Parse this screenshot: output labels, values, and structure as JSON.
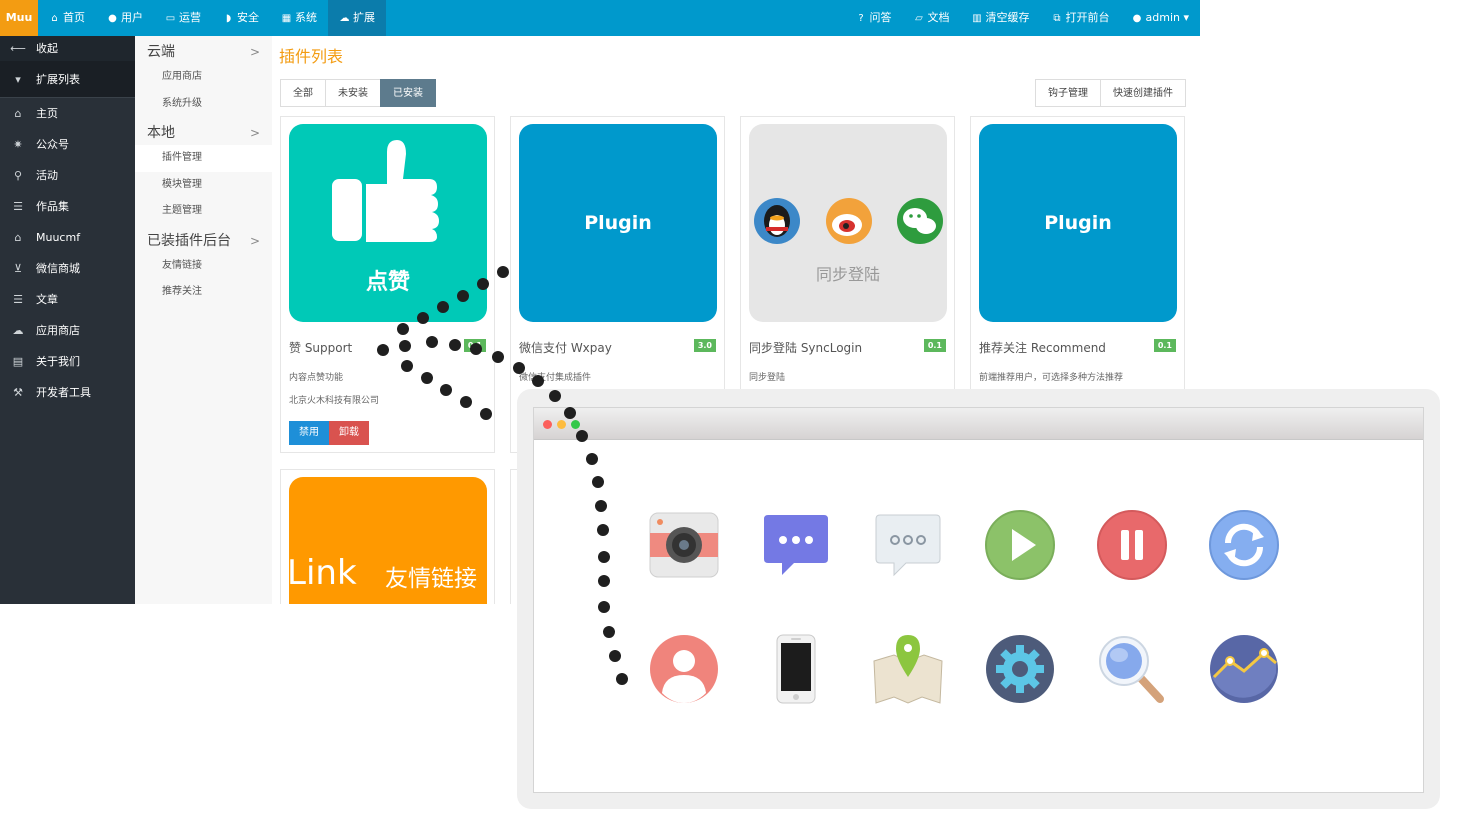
{
  "topbar": {
    "logo": "Muu",
    "nav": [
      {
        "label": "首页",
        "icon": "home-icon",
        "glyph": "⌂"
      },
      {
        "label": "用户",
        "icon": "user-icon",
        "glyph": "●"
      },
      {
        "label": "运营",
        "icon": "laptop-icon",
        "glyph": "▭"
      },
      {
        "label": "安全",
        "icon": "shield-icon",
        "glyph": "◗"
      },
      {
        "label": "系统",
        "icon": "windows-icon",
        "glyph": "▦"
      },
      {
        "label": "扩展",
        "icon": "cloud-icon",
        "glyph": "☁"
      }
    ],
    "right": [
      {
        "label": "问答",
        "icon": "question-icon",
        "glyph": "?"
      },
      {
        "label": "文档",
        "icon": "book-icon",
        "glyph": "▱"
      },
      {
        "label": "清空缓存",
        "icon": "trash-icon",
        "glyph": "▥"
      },
      {
        "label": "打开前台",
        "icon": "external-link-icon",
        "glyph": "⧉"
      },
      {
        "label": "admin",
        "icon": "user-icon",
        "glyph": "●"
      }
    ]
  },
  "sidebar": {
    "collapse": {
      "label": "收起",
      "icon": "arrow-left-icon",
      "glyph": "⟵"
    },
    "current": {
      "label": "扩展列表",
      "icon": "caret-down-icon",
      "glyph": "▾"
    },
    "items": [
      {
        "label": "主页",
        "icon": "home-icon",
        "glyph": "⌂"
      },
      {
        "label": "公众号",
        "icon": "gear-icon",
        "glyph": "✷"
      },
      {
        "label": "活动",
        "icon": "map-marker-icon",
        "glyph": "⚲"
      },
      {
        "label": "作品集",
        "icon": "list-icon",
        "glyph": "☰"
      },
      {
        "label": "Muucmf",
        "icon": "home-icon",
        "glyph": "⌂"
      },
      {
        "label": "微信商城",
        "icon": "cart-icon",
        "glyph": "⊻"
      },
      {
        "label": "文章",
        "icon": "list-icon",
        "glyph": "☰"
      },
      {
        "label": "应用商店",
        "icon": "cloud-download-icon",
        "glyph": "☁"
      },
      {
        "label": "关于我们",
        "icon": "file-icon",
        "glyph": "▤"
      },
      {
        "label": "开发者工具",
        "icon": "wrench-icon",
        "glyph": "⚒"
      }
    ]
  },
  "subnav": {
    "groups": [
      {
        "head": "云端",
        "items": [
          "应用商店",
          "系统升级"
        ]
      },
      {
        "head": "本地",
        "items": [
          "插件管理",
          "模块管理",
          "主题管理"
        ]
      },
      {
        "head": "已装插件后台",
        "items": [
          "友情链接",
          "推荐关注"
        ]
      }
    ],
    "active": "插件管理"
  },
  "main": {
    "title": "插件列表",
    "tabs": [
      "全部",
      "未安装",
      "已安装"
    ],
    "active_tab": "已安装",
    "tools": [
      "钩子管理",
      "快速创建插件"
    ]
  },
  "plugins": [
    {
      "title": "赞 Support",
      "version": "0.1",
      "desc": "内容点赞功能",
      "author": "北京火木科技有限公司",
      "image_text": "点赞",
      "image_color": "#00c9b7",
      "buttons": [
        "禁用",
        "卸载"
      ]
    },
    {
      "title": "微信支付 Wxpay",
      "version": "3.0",
      "desc": "微信支付集成插件",
      "image_text": "Plugin",
      "image_color": "#0099cc"
    },
    {
      "title": "同步登陆 SyncLogin",
      "version": "0.1",
      "desc": "同步登陆",
      "image_text": "同步登陆",
      "image_color": "#e6e6e6"
    },
    {
      "title": "推荐关注 Recommend",
      "version": "0.1",
      "desc": "前端推荐用户，可选择多种方法推荐",
      "image_text": "Plugin",
      "image_color": "#0099cc"
    },
    {
      "image_text_left": "Link",
      "image_text_right": "友情链接",
      "image_color": "#ff9900"
    }
  ],
  "browser": {
    "icons": [
      "camera-icon",
      "chat-bubble-purple-icon",
      "chat-bubble-gray-icon",
      "play-icon",
      "pause-icon",
      "refresh-icon",
      "contact-icon",
      "phone-icon",
      "map-pin-icon",
      "settings-icon",
      "magnifier-icon",
      "chart-icon"
    ]
  }
}
